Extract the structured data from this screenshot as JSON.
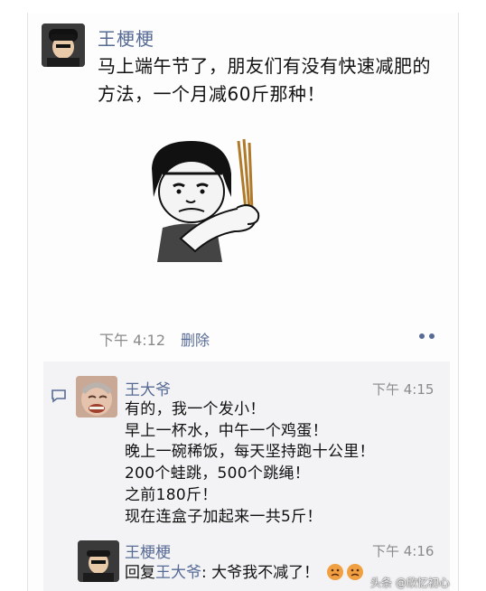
{
  "post": {
    "author": "王梗梗",
    "text": "马上端午节了，朋友们有没有快速减肥的方法，一个月减60斤那种！",
    "time": "下午 4:12",
    "delete_label": "删除"
  },
  "comments": [
    {
      "author": "王大爷",
      "time": "下午 4:15",
      "lines": [
        "有的，我一个发小！",
        "早上一杯水，中午一个鸡蛋！",
        "晚上一碗稀饭，每天坚持跑十公里！",
        "200个蛙跳，500个跳绳！",
        "之前180斤！",
        "现在连盒子加起来一共5斤！"
      ]
    },
    {
      "author": "王梗梗",
      "time": "下午 4:16",
      "reply_prefix": "回复",
      "reply_target": "王大爷",
      "reply_text": ": 大爷我不减了！"
    }
  ],
  "watermark": "头条 @欣忆初心",
  "icons": [
    "avatar-image",
    "meme-sticker",
    "more-dots-icon",
    "comment-icon",
    "sad-face-emoji"
  ],
  "colors": {
    "link": "#576b95",
    "meta": "#8a8a8a",
    "comment_bg": "#f3f3f5"
  }
}
